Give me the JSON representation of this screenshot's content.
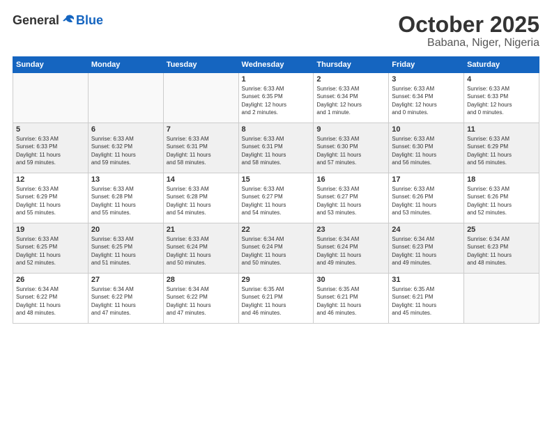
{
  "header": {
    "logo_general": "General",
    "logo_blue": "Blue",
    "month": "October 2025",
    "location": "Babana, Niger, Nigeria"
  },
  "days_of_week": [
    "Sunday",
    "Monday",
    "Tuesday",
    "Wednesday",
    "Thursday",
    "Friday",
    "Saturday"
  ],
  "weeks": [
    [
      {
        "day": "",
        "info": ""
      },
      {
        "day": "",
        "info": ""
      },
      {
        "day": "",
        "info": ""
      },
      {
        "day": "1",
        "info": "Sunrise: 6:33 AM\nSunset: 6:35 PM\nDaylight: 12 hours\nand 2 minutes."
      },
      {
        "day": "2",
        "info": "Sunrise: 6:33 AM\nSunset: 6:34 PM\nDaylight: 12 hours\nand 1 minute."
      },
      {
        "day": "3",
        "info": "Sunrise: 6:33 AM\nSunset: 6:34 PM\nDaylight: 12 hours\nand 0 minutes."
      },
      {
        "day": "4",
        "info": "Sunrise: 6:33 AM\nSunset: 6:33 PM\nDaylight: 12 hours\nand 0 minutes."
      }
    ],
    [
      {
        "day": "5",
        "info": "Sunrise: 6:33 AM\nSunset: 6:33 PM\nDaylight: 11 hours\nand 59 minutes."
      },
      {
        "day": "6",
        "info": "Sunrise: 6:33 AM\nSunset: 6:32 PM\nDaylight: 11 hours\nand 59 minutes."
      },
      {
        "day": "7",
        "info": "Sunrise: 6:33 AM\nSunset: 6:31 PM\nDaylight: 11 hours\nand 58 minutes."
      },
      {
        "day": "8",
        "info": "Sunrise: 6:33 AM\nSunset: 6:31 PM\nDaylight: 11 hours\nand 58 minutes."
      },
      {
        "day": "9",
        "info": "Sunrise: 6:33 AM\nSunset: 6:30 PM\nDaylight: 11 hours\nand 57 minutes."
      },
      {
        "day": "10",
        "info": "Sunrise: 6:33 AM\nSunset: 6:30 PM\nDaylight: 11 hours\nand 56 minutes."
      },
      {
        "day": "11",
        "info": "Sunrise: 6:33 AM\nSunset: 6:29 PM\nDaylight: 11 hours\nand 56 minutes."
      }
    ],
    [
      {
        "day": "12",
        "info": "Sunrise: 6:33 AM\nSunset: 6:29 PM\nDaylight: 11 hours\nand 55 minutes."
      },
      {
        "day": "13",
        "info": "Sunrise: 6:33 AM\nSunset: 6:28 PM\nDaylight: 11 hours\nand 55 minutes."
      },
      {
        "day": "14",
        "info": "Sunrise: 6:33 AM\nSunset: 6:28 PM\nDaylight: 11 hours\nand 54 minutes."
      },
      {
        "day": "15",
        "info": "Sunrise: 6:33 AM\nSunset: 6:27 PM\nDaylight: 11 hours\nand 54 minutes."
      },
      {
        "day": "16",
        "info": "Sunrise: 6:33 AM\nSunset: 6:27 PM\nDaylight: 11 hours\nand 53 minutes."
      },
      {
        "day": "17",
        "info": "Sunrise: 6:33 AM\nSunset: 6:26 PM\nDaylight: 11 hours\nand 53 minutes."
      },
      {
        "day": "18",
        "info": "Sunrise: 6:33 AM\nSunset: 6:26 PM\nDaylight: 11 hours\nand 52 minutes."
      }
    ],
    [
      {
        "day": "19",
        "info": "Sunrise: 6:33 AM\nSunset: 6:25 PM\nDaylight: 11 hours\nand 52 minutes."
      },
      {
        "day": "20",
        "info": "Sunrise: 6:33 AM\nSunset: 6:25 PM\nDaylight: 11 hours\nand 51 minutes."
      },
      {
        "day": "21",
        "info": "Sunrise: 6:33 AM\nSunset: 6:24 PM\nDaylight: 11 hours\nand 50 minutes."
      },
      {
        "day": "22",
        "info": "Sunrise: 6:34 AM\nSunset: 6:24 PM\nDaylight: 11 hours\nand 50 minutes."
      },
      {
        "day": "23",
        "info": "Sunrise: 6:34 AM\nSunset: 6:24 PM\nDaylight: 11 hours\nand 49 minutes."
      },
      {
        "day": "24",
        "info": "Sunrise: 6:34 AM\nSunset: 6:23 PM\nDaylight: 11 hours\nand 49 minutes."
      },
      {
        "day": "25",
        "info": "Sunrise: 6:34 AM\nSunset: 6:23 PM\nDaylight: 11 hours\nand 48 minutes."
      }
    ],
    [
      {
        "day": "26",
        "info": "Sunrise: 6:34 AM\nSunset: 6:22 PM\nDaylight: 11 hours\nand 48 minutes."
      },
      {
        "day": "27",
        "info": "Sunrise: 6:34 AM\nSunset: 6:22 PM\nDaylight: 11 hours\nand 47 minutes."
      },
      {
        "day": "28",
        "info": "Sunrise: 6:34 AM\nSunset: 6:22 PM\nDaylight: 11 hours\nand 47 minutes."
      },
      {
        "day": "29",
        "info": "Sunrise: 6:35 AM\nSunset: 6:21 PM\nDaylight: 11 hours\nand 46 minutes."
      },
      {
        "day": "30",
        "info": "Sunrise: 6:35 AM\nSunset: 6:21 PM\nDaylight: 11 hours\nand 46 minutes."
      },
      {
        "day": "31",
        "info": "Sunrise: 6:35 AM\nSunset: 6:21 PM\nDaylight: 11 hours\nand 45 minutes."
      },
      {
        "day": "",
        "info": ""
      }
    ]
  ]
}
